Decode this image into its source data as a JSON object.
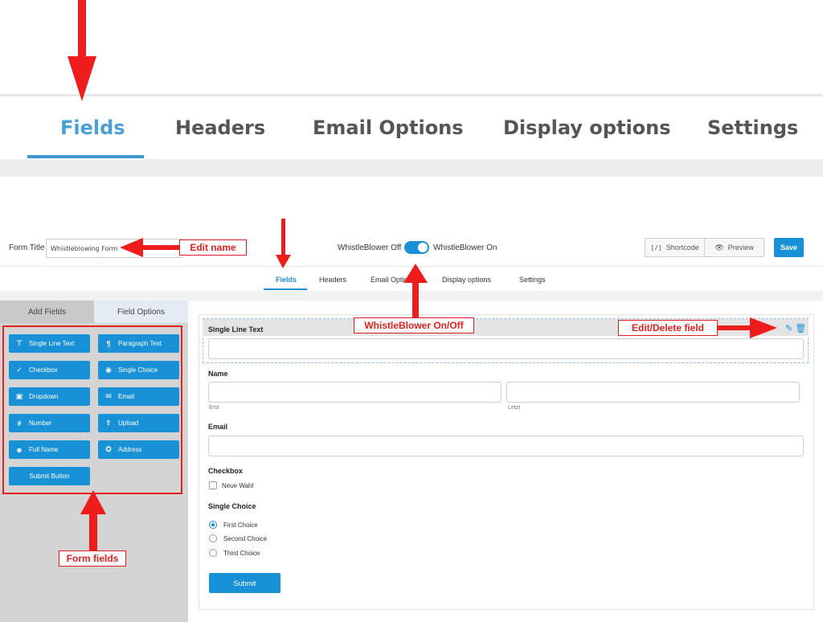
{
  "top_tabs": [
    "Fields",
    "Headers",
    "Email Options",
    "Display options",
    "Settings"
  ],
  "header": {
    "form_title_label": "Form Title",
    "form_title_value": "Whistleblowing Form",
    "whistleblower_off": "WhistleBlower Off",
    "whistleblower_on": "WhistleBlower On",
    "shortcode": "Shortcode",
    "preview": "Preview",
    "save": "Save"
  },
  "tabs": [
    "Fields",
    "Headers",
    "Email Options",
    "Display options",
    "Settings"
  ],
  "left_panel": {
    "tab_add": "Add Fields",
    "tab_options": "Field Options",
    "buttons": [
      {
        "label": "Single Line Text",
        "icon": "text-icon"
      },
      {
        "label": "Paragraph Text",
        "icon": "paragraph-icon"
      },
      {
        "label": "Checkbox",
        "icon": "check-icon"
      },
      {
        "label": "Single Choice",
        "icon": "radio-icon"
      },
      {
        "label": "Dropdown",
        "icon": "dropdown-icon"
      },
      {
        "label": "Email",
        "icon": "envelope-icon"
      },
      {
        "label": "Number",
        "icon": "hash-icon"
      },
      {
        "label": "Upload",
        "icon": "upload-icon"
      },
      {
        "label": "Full Name",
        "icon": "user-icon"
      },
      {
        "label": "Address",
        "icon": "map-pin-icon"
      },
      {
        "label": "Submit Button",
        "icon": ""
      }
    ]
  },
  "form": {
    "single_line_label": "Single Line Text",
    "name_label": "Name",
    "first_sub": "Erst",
    "last_sub": "Letzt",
    "email_label": "Email",
    "checkbox_label": "Checkbox",
    "checkbox_option": "Neue Wahl",
    "single_choice_label": "Single Choice",
    "choices": [
      "First Choice",
      "Second Choice",
      "Third Choice"
    ],
    "submit": "Submit"
  },
  "annotations": {
    "edit_name": "Edit name",
    "whistleblower_toggle": "WhistleBlower On/Off",
    "edit_delete": "Edit/Delete field",
    "form_fields": "Form fields"
  },
  "colors": {
    "accent": "#1991d6",
    "annotation_red": "#e82020"
  }
}
